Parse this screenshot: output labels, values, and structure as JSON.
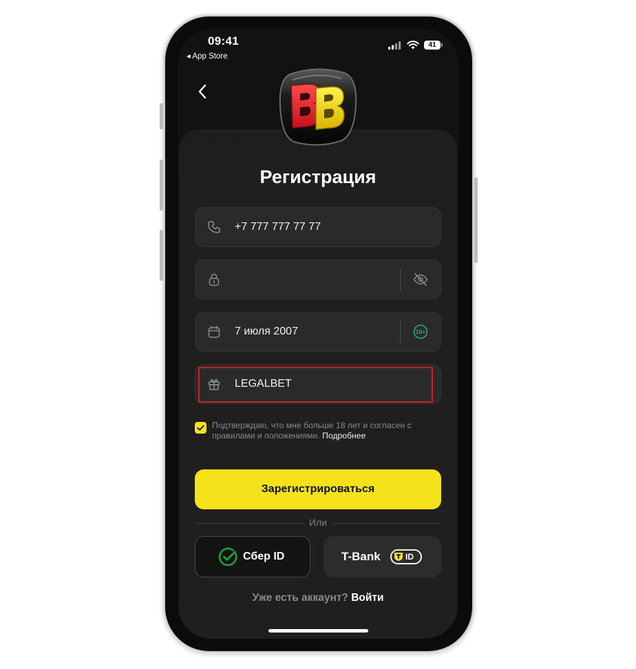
{
  "status_bar": {
    "time": "09:41",
    "back_label": "◂ App Store",
    "battery": "41"
  },
  "header": {
    "back_icon": "chevron-left-icon",
    "logo_text": "BB",
    "title": "Регистрация"
  },
  "fields": {
    "phone": {
      "icon": "phone-icon",
      "value": "+7 777 777 77 77"
    },
    "password": {
      "icon": "lock-icon",
      "value": "",
      "toggle_icon": "eye-off-icon"
    },
    "birthdate": {
      "icon": "calendar-icon",
      "value": "7 июля 2007",
      "age_badge": "18+"
    },
    "promo": {
      "icon": "gift-icon",
      "value": "LEGALBET"
    }
  },
  "consent": {
    "checked": true,
    "text": "Подтверждаю, что мне больше 18 лет и согласен с правилами и положениями.",
    "link": "Подробнее"
  },
  "actions": {
    "register_label": "Зарегистрироваться",
    "or_label": "Или",
    "sber_label": "Сбер ID",
    "tbank_label": "T-Bank",
    "tbank_badge": "ID"
  },
  "footer": {
    "question": "Уже есть аккаунт?",
    "login_label": "Войти"
  },
  "colors": {
    "accent": "#f5e21b",
    "background": "#121212",
    "field": "#2a2a2a",
    "highlight": "#cc1f22",
    "sber_green": "#21a038"
  }
}
